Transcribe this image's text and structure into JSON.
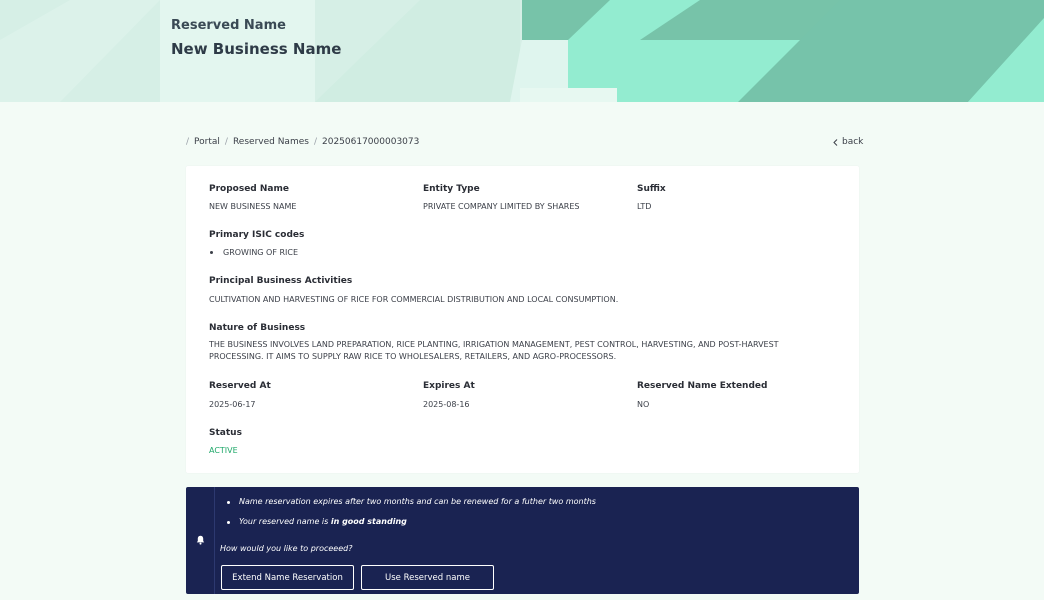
{
  "hero": {
    "eyebrow": "Reserved Name",
    "title": "New Business Name"
  },
  "breadcrumb": {
    "items": [
      "Portal",
      "Reserved Names",
      "20250617000003073"
    ]
  },
  "back_label": "back",
  "details": {
    "proposed_name": {
      "label": "Proposed Name",
      "value": "NEW BUSINESS NAME"
    },
    "entity_type": {
      "label": "Entity Type",
      "value": "PRIVATE COMPANY LIMITED BY SHARES"
    },
    "suffix": {
      "label": "Suffix",
      "value": "LTD"
    },
    "isic": {
      "label": "Primary ISIC codes",
      "items": [
        "GROWING OF RICE"
      ]
    },
    "activities": {
      "label": "Principal Business Activities",
      "value": "CULTIVATION AND HARVESTING OF RICE FOR COMMERCIAL DISTRIBUTION AND LOCAL CONSUMPTION."
    },
    "nature": {
      "label": "Nature of Business",
      "value": "THE BUSINESS INVOLVES LAND PREPARATION, RICE PLANTING, IRRIGATION MANAGEMENT, PEST CONTROL, HARVESTING, AND POST-HARVEST PROCESSING. IT AIMS TO SUPPLY RAW RICE TO WHOLESALERS, RETAILERS, AND AGRO-PROCESSORS."
    },
    "reserved_at": {
      "label": "Reserved At",
      "value": "2025-06-17"
    },
    "expires_at": {
      "label": "Expires At",
      "value": "2025-08-16"
    },
    "extended": {
      "label": "Reserved Name Extended",
      "value": "NO"
    },
    "status": {
      "label": "Status",
      "value": "ACTIVE"
    }
  },
  "notice": {
    "line1": "Name reservation expires after two months and can be renewed for a futher two months",
    "line2_prefix": "Your reserved name is ",
    "line2_bold": "in good standing",
    "question": "How would you like to proceeed?",
    "extend_button": "Extend Name Reservation",
    "use_button": "Use Reserved name"
  },
  "colors": {
    "hero_bg": "#d6efe6",
    "accent_green": "#20a86a",
    "notice_bg": "#1a2352",
    "page_bg": "#f3fbf6"
  }
}
